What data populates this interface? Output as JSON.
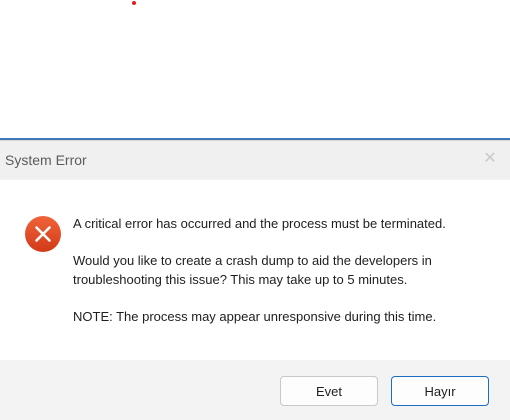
{
  "dialog": {
    "title": "System Error",
    "close_glyph": "✕",
    "icon": "error-icon",
    "messages": [
      "A critical error has occurred and the process must be terminated.",
      "Would you like to create a crash dump to aid the developers in troubleshooting this issue? This may take up to 5 minutes.",
      "NOTE: The process may appear unresponsive during this time."
    ],
    "buttons": {
      "yes_label": "Evet",
      "no_label": "Hayır"
    }
  },
  "colors": {
    "error_icon": "#e0431f",
    "default_button_border": "#1a6fc2",
    "red_dot": "#e0211b"
  }
}
